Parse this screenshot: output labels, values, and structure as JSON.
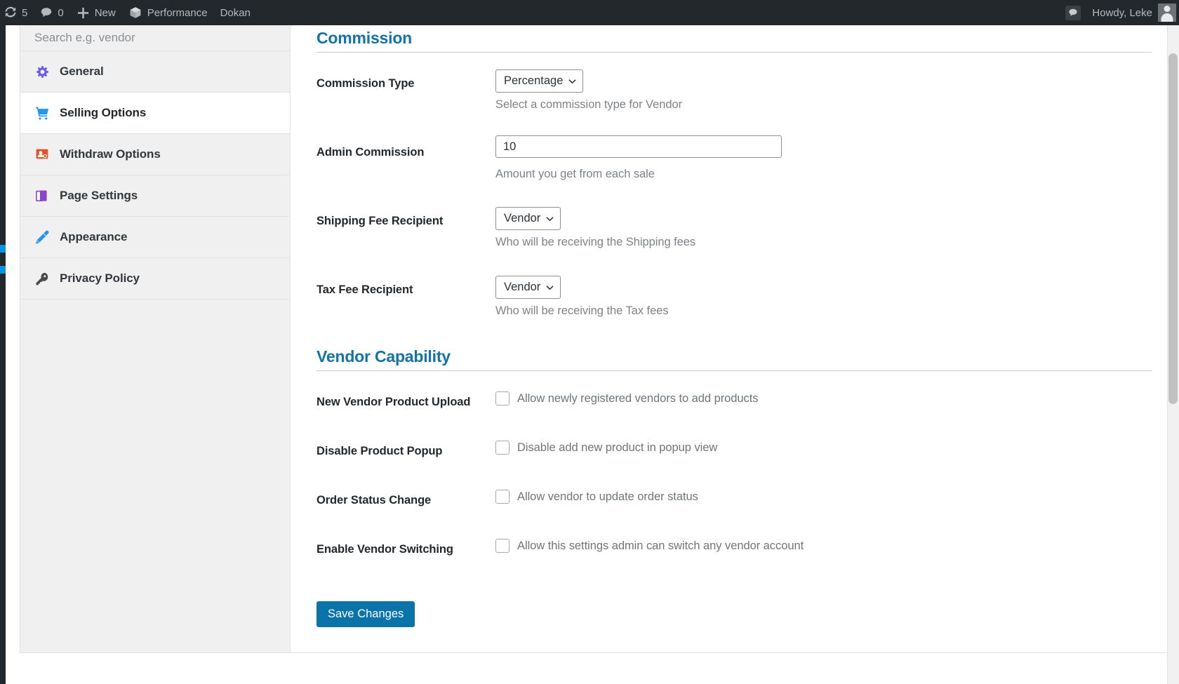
{
  "adminbar": {
    "updates_icon": "update-icon",
    "updates_count": "5",
    "comments_icon": "comment-icon",
    "comments_count": "0",
    "new_icon": "plus-icon",
    "new_label": "New",
    "performance_icon": "cube-icon",
    "performance_label": "Performance",
    "dokan_label": "Dokan",
    "notification_icon": "comment-bubble-icon",
    "howdy_label": "Howdy, Leke",
    "avatar": "user-avatar"
  },
  "sidebar": {
    "search_placeholder": "Search e.g. vendor",
    "items": [
      {
        "label": "General",
        "icon": "gear-icon",
        "active": false
      },
      {
        "label": "Selling Options",
        "icon": "cart-icon",
        "active": true
      },
      {
        "label": "Withdraw Options",
        "icon": "withdraw-user-icon",
        "active": false
      },
      {
        "label": "Page Settings",
        "icon": "pages-icon",
        "active": false
      },
      {
        "label": "Appearance",
        "icon": "brush-icon",
        "active": false
      },
      {
        "label": "Privacy Policy",
        "icon": "key-icon",
        "active": false
      }
    ]
  },
  "content": {
    "commission": {
      "title": "Commission",
      "fields": {
        "commission_type": {
          "label": "Commission Type",
          "value": "Percentage",
          "help": "Select a commission type for Vendor"
        },
        "admin_commission": {
          "label": "Admin Commission",
          "value": "10",
          "help": "Amount you get from each sale"
        },
        "shipping_fee_recipient": {
          "label": "Shipping Fee Recipient",
          "value": "Vendor",
          "help": "Who will be receiving the Shipping fees"
        },
        "tax_fee_recipient": {
          "label": "Tax Fee Recipient",
          "value": "Vendor",
          "help": "Who will be receiving the Tax fees"
        }
      }
    },
    "vendor_capability": {
      "title": "Vendor Capability",
      "rows": [
        {
          "label": "New Vendor Product Upload",
          "checkbox_label": "Allow newly registered vendors to add products",
          "checked": false
        },
        {
          "label": "Disable Product Popup",
          "checkbox_label": "Disable add new product in popup view",
          "checked": false
        },
        {
          "label": "Order Status Change",
          "checkbox_label": "Allow vendor to update order status",
          "checked": false
        },
        {
          "label": "Enable Vendor Switching",
          "checkbox_label": "Allow this settings admin can switch any vendor account",
          "checked": false
        }
      ]
    },
    "save_label": "Save Changes"
  },
  "colors": {
    "adminbar_bg": "#23282d",
    "section_heading": "#1273aa",
    "primary_button": "#0a73aa",
    "sidebar_bg": "#f0f0f0",
    "active_item_bg": "#ffffff"
  }
}
